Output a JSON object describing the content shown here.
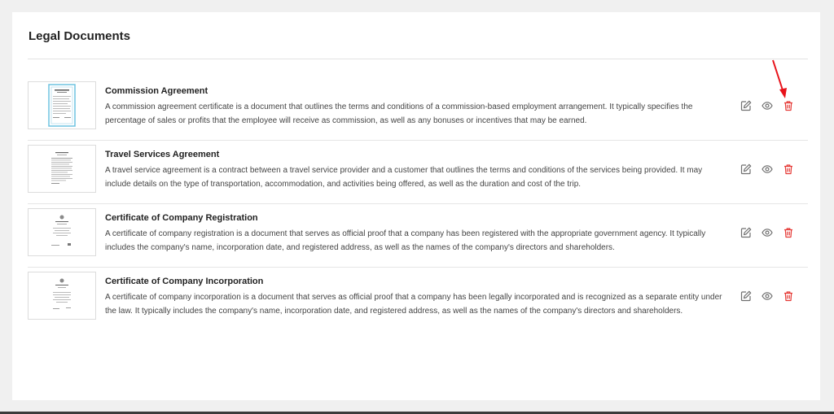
{
  "page": {
    "title": "Legal Documents"
  },
  "documents": [
    {
      "title": "Commission Agreement",
      "description": "A commission agreement certificate is a document that outlines the terms and conditions of a commission-based employment arrangement. It typically specifies the percentage of sales or profits that the employee will receive as commission, as well as any bonuses or incentives that may be earned."
    },
    {
      "title": "Travel Services Agreement",
      "description": "A travel service agreement is a contract between a travel service provider and a customer that outlines the terms and conditions of the services being provided. It may include details on the type of transportation, accommodation, and activities being offered, as well as the duration and cost of the trip."
    },
    {
      "title": "Certificate of Company Registration",
      "description": "A certificate of company registration is a document that serves as official proof that a company has been registered with the appropriate government agency. It typically includes the company's name, incorporation date, and registered address, as well as the names of the company's directors and shareholders."
    },
    {
      "title": "Certificate of Company Incorporation",
      "description": "A certificate of company incorporation is a document that serves as official proof that a company has been legally incorporated and is recognized as a separate entity under the law. It typically includes the company's name, incorporation date, and registered address, as well as the names of the company's directors and shareholders."
    }
  ],
  "icons": {
    "edit": "edit-icon",
    "view": "eye-icon",
    "delete": "trash-icon"
  },
  "colors": {
    "icon_gray": "#6f6f6f",
    "delete_red": "#e53935",
    "annotation_arrow": "#e8121a",
    "thumb_accent": "#6ec3e0"
  }
}
